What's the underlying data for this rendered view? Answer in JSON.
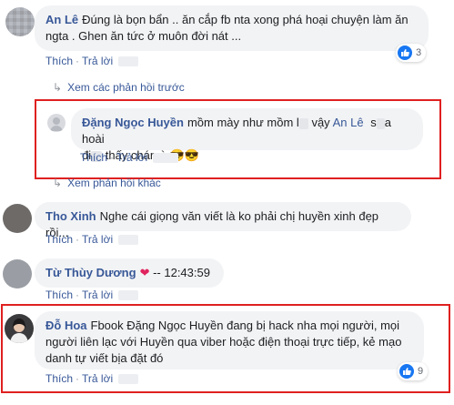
{
  "colors": {
    "link": "#385898",
    "highlight_border": "#e02020",
    "bubble": "#f2f3f5",
    "like_blue": "#1877f2"
  },
  "comments": [
    {
      "author": "An Lê",
      "text_line1": "Đúng là bọn bẩn .. ăn cắp fb nta xong phá hoại chuyện làm ăn",
      "text_line2": "ngta . Ghen ăn tức ở muôn đời nát ...",
      "like_label": "Thích",
      "reply_label": "Trả lời",
      "reaction_count": "3"
    },
    {
      "author": "Đặng Ngọc Huyền",
      "text_line1a": "mồm mày như mồm l",
      "text_line1b": "vậy",
      "mention": "An Lê",
      "text_line1c": "s",
      "text_line1d": "a hoài",
      "text_line2a": "đi",
      "text_line2b": "thấy chán à 😎😎",
      "like_label": "Thích",
      "reply_label": "Trả lời"
    },
    {
      "author": "Tho Xinh",
      "text": "Nghe cái giọng văn viết là ko phải chị huyền xinh đẹp rồi...",
      "like_label": "Thích",
      "reply_label": "Trả lời"
    },
    {
      "author": "Từ Thùy Dương",
      "text": "-- 12:43:59",
      "like_label": "Thích",
      "reply_label": "Trả lời"
    },
    {
      "author": "Đỗ Hoa",
      "text_line1": "Fbook Đặng Ngọc Huyền đang bị hack nha mọi người, mọi",
      "text_line2": "người liên lạc với Huyền qua viber hoặc điện thoại trực tiếp, kẻ mạo",
      "text_line3": "danh tự viết bịa đặt đó",
      "like_label": "Thích",
      "reply_label": "Trả lời",
      "reaction_count": "9"
    }
  ],
  "view_previous_replies": "Xem các phản hồi trước",
  "view_more_replies": "Xem phản hồi khác",
  "icons": {
    "like": "thumbs-up-icon",
    "heart": "heart-emoji-icon",
    "reply_arrow": "reply-arrow-icon"
  }
}
